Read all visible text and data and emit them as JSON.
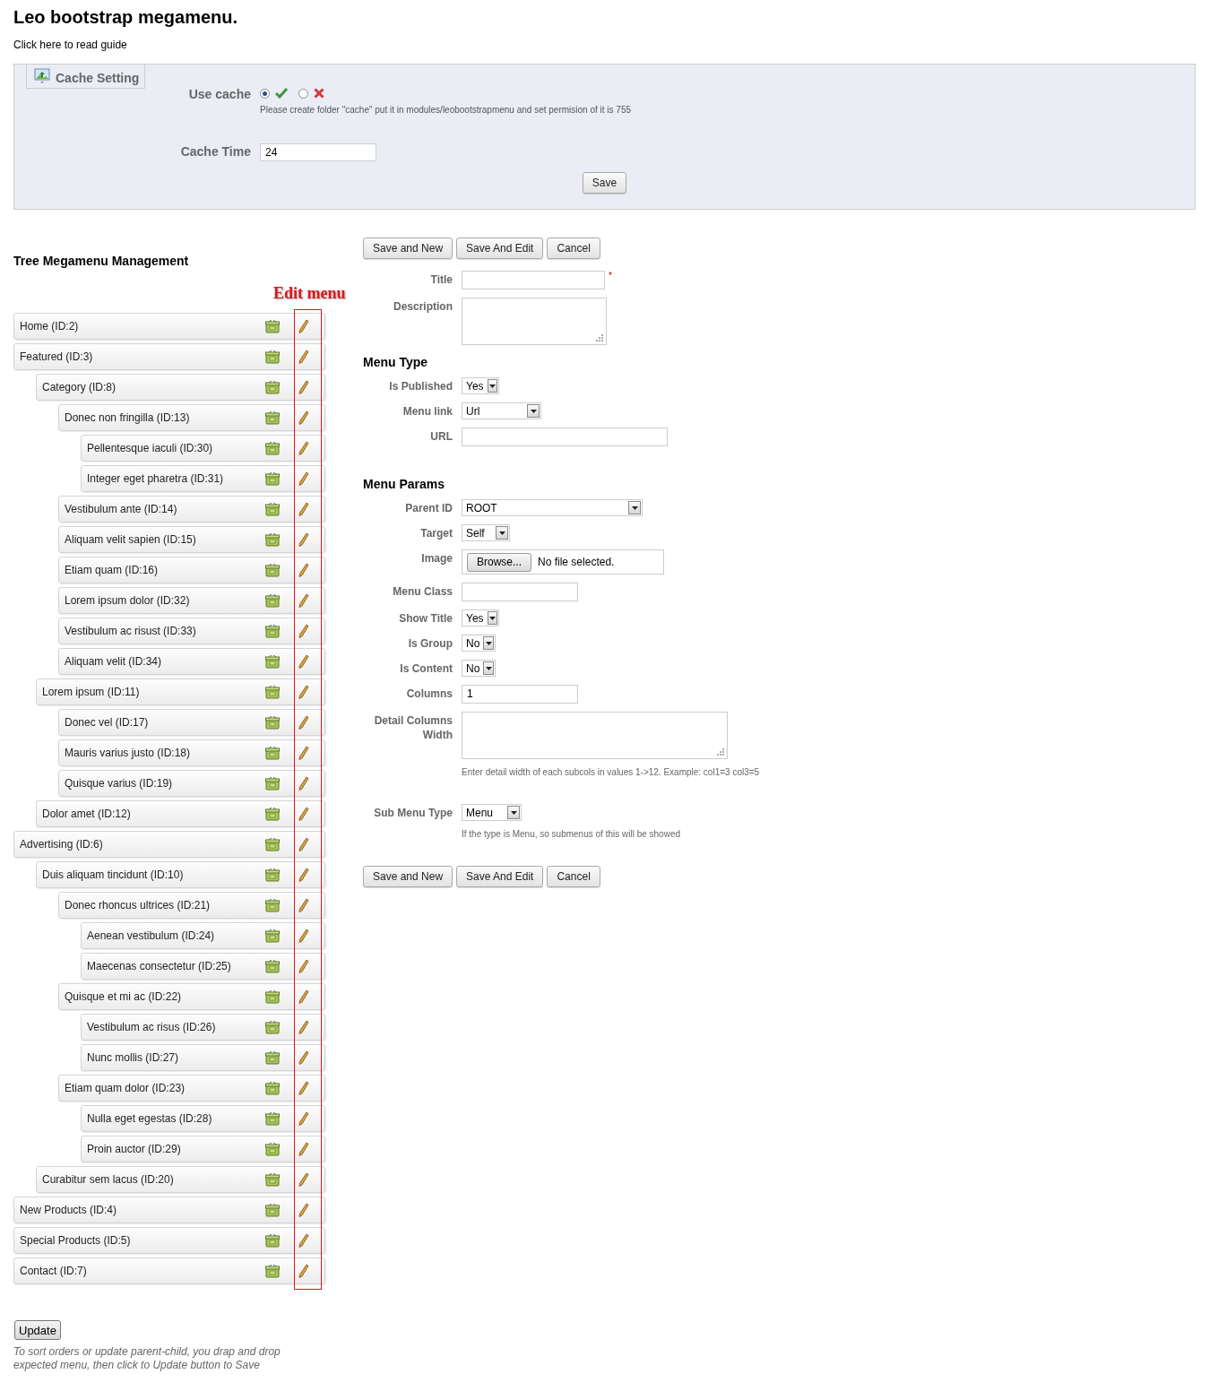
{
  "page_title": "Leo bootstrap megamenu.",
  "guide_link": "Click here to read guide",
  "cache_setting": {
    "legend": "Cache Setting",
    "use_cache": {
      "label": "Use cache",
      "options": [
        {
          "kind": "yes",
          "selected": true
        },
        {
          "kind": "no",
          "selected": false
        }
      ],
      "help": "Please create folder \"cache\" put it in modules/leobootstrapmenu and set permision of it is 755"
    },
    "cache_time": {
      "label": "Cache Time",
      "value": "24"
    },
    "save_button": "Save"
  },
  "tree": {
    "heading": "Tree Megamenu Management",
    "annotation": "Edit menu",
    "items": [
      {
        "label": "Home (ID:2)"
      },
      {
        "label": "Featured (ID:3)",
        "children": [
          {
            "label": "Category (ID:8)",
            "children": [
              {
                "label": "Donec non fringilla (ID:13)",
                "children": [
                  {
                    "label": "Pellentesque iaculi (ID:30)"
                  },
                  {
                    "label": "Integer eget pharetra (ID:31)"
                  }
                ]
              },
              {
                "label": "Vestibulum ante (ID:14)"
              },
              {
                "label": "Aliquam velit sapien (ID:15)"
              },
              {
                "label": "Etiam quam (ID:16)"
              },
              {
                "label": "Lorem ipsum dolor (ID:32)"
              },
              {
                "label": "Vestibulum ac risust (ID:33)"
              },
              {
                "label": "Aliquam velit (ID:34)"
              }
            ]
          },
          {
            "label": "Lorem ipsum (ID:11)",
            "children": [
              {
                "label": "Donec vel (ID:17)"
              },
              {
                "label": "Mauris varius justo (ID:18)"
              },
              {
                "label": "Quisque varius (ID:19)"
              }
            ]
          },
          {
            "label": "Dolor amet (ID:12)"
          }
        ]
      },
      {
        "label": "Advertising (ID:6)",
        "children": [
          {
            "label": "Duis aliquam tincidunt (ID:10)",
            "children": [
              {
                "label": "Donec rhoncus ultrices (ID:21)",
                "children": [
                  {
                    "label": "Aenean vestibulum (ID:24)"
                  },
                  {
                    "label": "Maecenas consectetur (ID:25)"
                  }
                ]
              },
              {
                "label": "Quisque et mi ac (ID:22)",
                "children": [
                  {
                    "label": "Vestibulum ac risus (ID:26)"
                  },
                  {
                    "label": "Nunc mollis (ID:27)"
                  }
                ]
              },
              {
                "label": "Etiam quam dolor (ID:23)",
                "children": [
                  {
                    "label": "Nulla eget egestas (ID:28)"
                  },
                  {
                    "label": "Proin auctor (ID:29)"
                  }
                ]
              }
            ]
          },
          {
            "label": "Curabitur sem lacus (ID:20)"
          }
        ]
      },
      {
        "label": "New Products (ID:4)"
      },
      {
        "label": "Special Products (ID:5)"
      },
      {
        "label": "Contact (ID:7)"
      }
    ],
    "update_button": "Update",
    "note": "To sort orders or update parent-child, you drap and drop expected menu, then click to Update button to Save"
  },
  "form": {
    "top_buttons": [
      "Save and New",
      "Save And Edit",
      "Cancel"
    ],
    "fields": [
      {
        "kind": "text",
        "label": "Title",
        "required_mark": "*"
      },
      {
        "kind": "textarea",
        "label": "Description"
      }
    ],
    "sections": [
      {
        "heading": "Menu Type",
        "fields": [
          {
            "kind": "select",
            "label": "Is Published",
            "value": "Yes"
          },
          {
            "kind": "select",
            "label": "Menu link",
            "value": "Url"
          },
          {
            "kind": "text",
            "label": "URL"
          }
        ]
      },
      {
        "heading": "Menu Params",
        "fields": [
          {
            "kind": "select",
            "label": "Parent ID",
            "value": "ROOT"
          },
          {
            "kind": "select",
            "label": "Target",
            "value": "Self"
          },
          {
            "kind": "file",
            "label": "Image",
            "button": "Browse...",
            "status": "No file selected."
          },
          {
            "kind": "text",
            "label": "Menu Class"
          },
          {
            "kind": "select",
            "label": "Show Title",
            "value": "Yes"
          },
          {
            "kind": "select",
            "label": "Is Group",
            "value": "No"
          },
          {
            "kind": "select",
            "label": "Is Content",
            "value": "No"
          },
          {
            "kind": "text",
            "label": "Columns",
            "value": "1"
          },
          {
            "kind": "textarea",
            "label": "Detail Columns Width",
            "help": "Enter detail width of each subcols in values 1->12. Example: col1=3 col3=5"
          },
          {
            "kind": "select",
            "label": "Sub Menu Type",
            "value": "Menu",
            "help": "If the type is Menu, so submenus of this will be showed"
          }
        ]
      }
    ],
    "bottom_buttons": [
      "Save and New",
      "Save And Edit",
      "Cancel"
    ]
  }
}
